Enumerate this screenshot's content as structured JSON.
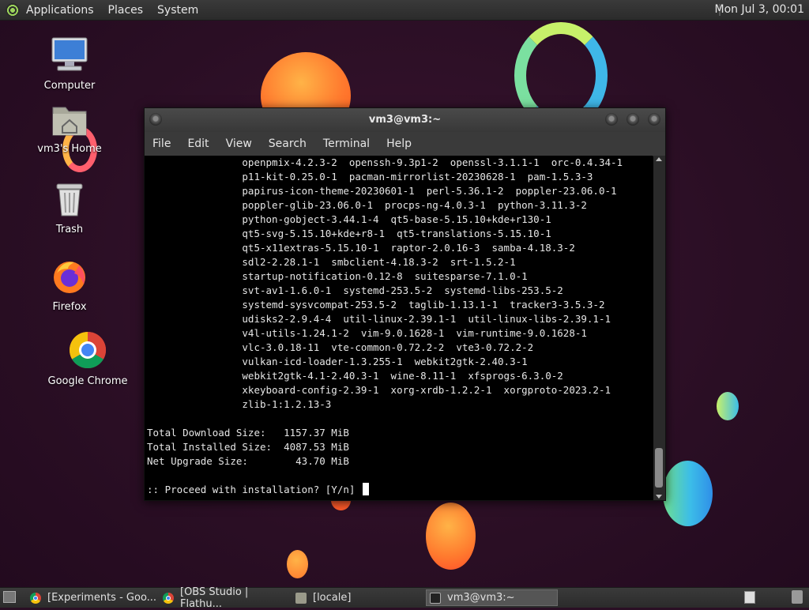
{
  "top_panel": {
    "menus": [
      "Applications",
      "Places",
      "System"
    ],
    "clock": "Mon Jul 3, 00:01"
  },
  "desktop_icons": [
    {
      "label": "Computer",
      "icon": "computer-icon"
    },
    {
      "label": "vm3's Home",
      "icon": "home-folder-icon"
    },
    {
      "label": "Trash",
      "icon": "trash-icon"
    },
    {
      "label": "Firefox",
      "icon": "firefox-icon"
    },
    {
      "label": "Google Chrome",
      "icon": "chrome-icon"
    }
  ],
  "terminal": {
    "title": "vm3@vm3:~",
    "menu": [
      "File",
      "Edit",
      "View",
      "Search",
      "Terminal",
      "Help"
    ],
    "lines": [
      "                openpmix-4.2.3-2  openssh-9.3p1-2  openssl-3.1.1-1  orc-0.4.34-1",
      "                p11-kit-0.25.0-1  pacman-mirrorlist-20230628-1  pam-1.5.3-3",
      "                papirus-icon-theme-20230601-1  perl-5.36.1-2  poppler-23.06.0-1",
      "                poppler-glib-23.06.0-1  procps-ng-4.0.3-1  python-3.11.3-2",
      "                python-gobject-3.44.1-4  qt5-base-5.15.10+kde+r130-1",
      "                qt5-svg-5.15.10+kde+r8-1  qt5-translations-5.15.10-1",
      "                qt5-x11extras-5.15.10-1  raptor-2.0.16-3  samba-4.18.3-2",
      "                sdl2-2.28.1-1  smbclient-4.18.3-2  srt-1.5.2-1",
      "                startup-notification-0.12-8  suitesparse-7.1.0-1",
      "                svt-av1-1.6.0-1  systemd-253.5-2  systemd-libs-253.5-2",
      "                systemd-sysvcompat-253.5-2  taglib-1.13.1-1  tracker3-3.5.3-2",
      "                udisks2-2.9.4-4  util-linux-2.39.1-1  util-linux-libs-2.39.1-1",
      "                v4l-utils-1.24.1-2  vim-9.0.1628-1  vim-runtime-9.0.1628-1",
      "                vlc-3.0.18-11  vte-common-0.72.2-2  vte3-0.72.2-2",
      "                vulkan-icd-loader-1.3.255-1  webkit2gtk-2.40.3-1",
      "                webkit2gtk-4.1-2.40.3-1  wine-8.11-1  xfsprogs-6.3.0-2",
      "                xkeyboard-config-2.39-1  xorg-xrdb-1.2.2-1  xorgproto-2023.2-1",
      "                zlib-1:1.2.13-3",
      "",
      "Total Download Size:   1157.37 MiB",
      "Total Installed Size:  4087.53 MiB",
      "Net Upgrade Size:        43.70 MiB",
      ""
    ],
    "prompt": ":: Proceed with installation? [Y/n] "
  },
  "taskbar": {
    "tasks": [
      {
        "label": "[Experiments - Goo...",
        "icon": "chrome-icon"
      },
      {
        "label": "[OBS Studio | Flathu...",
        "icon": "chrome-icon"
      },
      {
        "label": "[locale]",
        "icon": "folder-icon"
      },
      {
        "label": "vm3@vm3:~",
        "icon": "terminal-icon"
      }
    ]
  }
}
